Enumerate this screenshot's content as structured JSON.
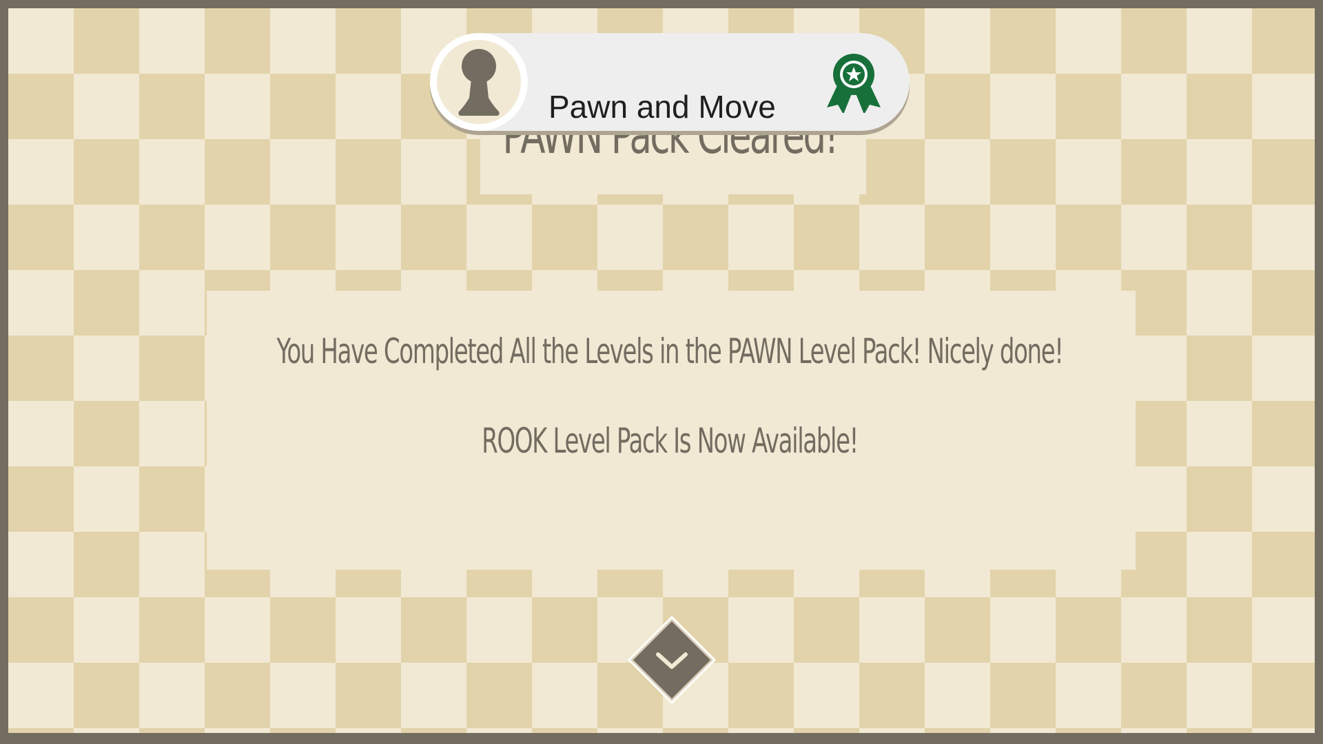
{
  "screen": {
    "title": "PAWN Pack Cleared!",
    "messages": [
      "You Have Completed All the Levels in the PAWN Level Pack! Nicely done!",
      "ROOK Level Pack Is Now Available!"
    ]
  },
  "achievement_toast": {
    "title": "Pawn and Move",
    "avatar_icon": "pawn-icon",
    "badge_icon": "award-ribbon-icon"
  },
  "navigation": {
    "next_icon": "chevron-down-icon"
  },
  "colors": {
    "frame": "#736c60",
    "tile_light": "#f1e9d4",
    "tile_dark": "#e2d3aa",
    "text": "#736c60",
    "toast_bg": "#eeeeee",
    "badge_green": "#17703a"
  }
}
